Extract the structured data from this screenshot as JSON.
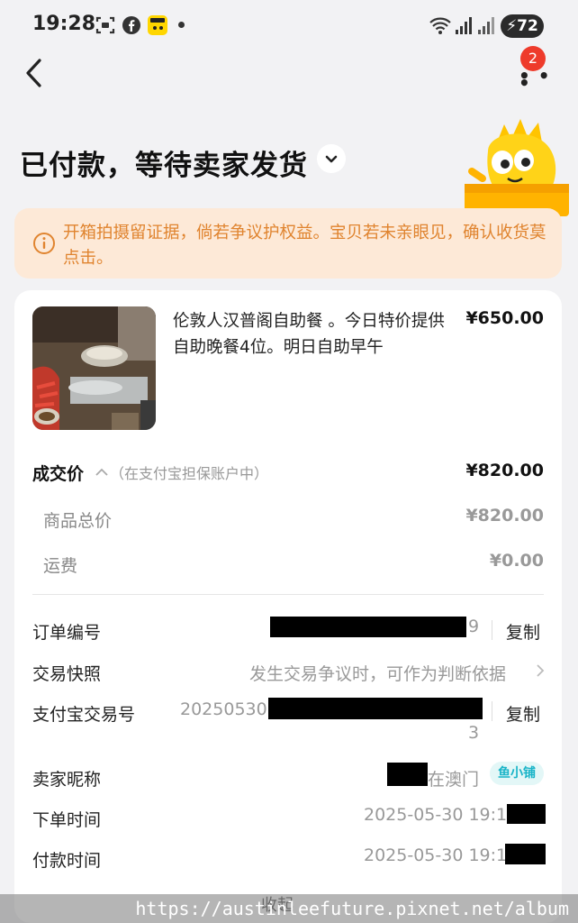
{
  "status_bar": {
    "time": "19:28",
    "battery": "72",
    "icons": [
      "screenshot-icon",
      "facebook-icon",
      "app-icon",
      "wifi-icon",
      "signal-icon"
    ]
  },
  "nav": {
    "notification_count": "2"
  },
  "title": "已付款，等待卖家发货",
  "warning": {
    "text": "开箱拍摄留证据，倘若争议护权益。宝贝若未亲眼见，确认收货莫点击。"
  },
  "item": {
    "title": "伦敦人汉普阁自助餐 。今日特价提供自助晚餐4位。明日自助早午",
    "price": "¥650.00"
  },
  "deal": {
    "label": "成交价",
    "hint": "（在支付宝担保账户中）",
    "value": "¥820.00",
    "goods_label": "商品总价",
    "goods_value": "¥820.00",
    "shipping_label": "运费",
    "shipping_value": "¥0.00"
  },
  "order": {
    "number_label": "订单编号",
    "number_tail": "9",
    "copy": "复制",
    "snapshot_label": "交易快照",
    "snapshot_value": "发生交易争议时，可作为判断依据",
    "alipay_label": "支付宝交易号",
    "alipay_prefix": "20250530",
    "alipay_tail": "3",
    "seller_label": "卖家昵称",
    "seller_value": "在澳门",
    "seller_badge": "鱼小铺",
    "order_time_label": "下单时间",
    "order_time_value": "2025-05-30 19:1",
    "pay_time_label": "付款时间",
    "pay_time_value": "2025-05-30 19:1"
  },
  "bottom_peek": "收起",
  "watermark": "https://austinleefuture.pixnet.net/album"
}
